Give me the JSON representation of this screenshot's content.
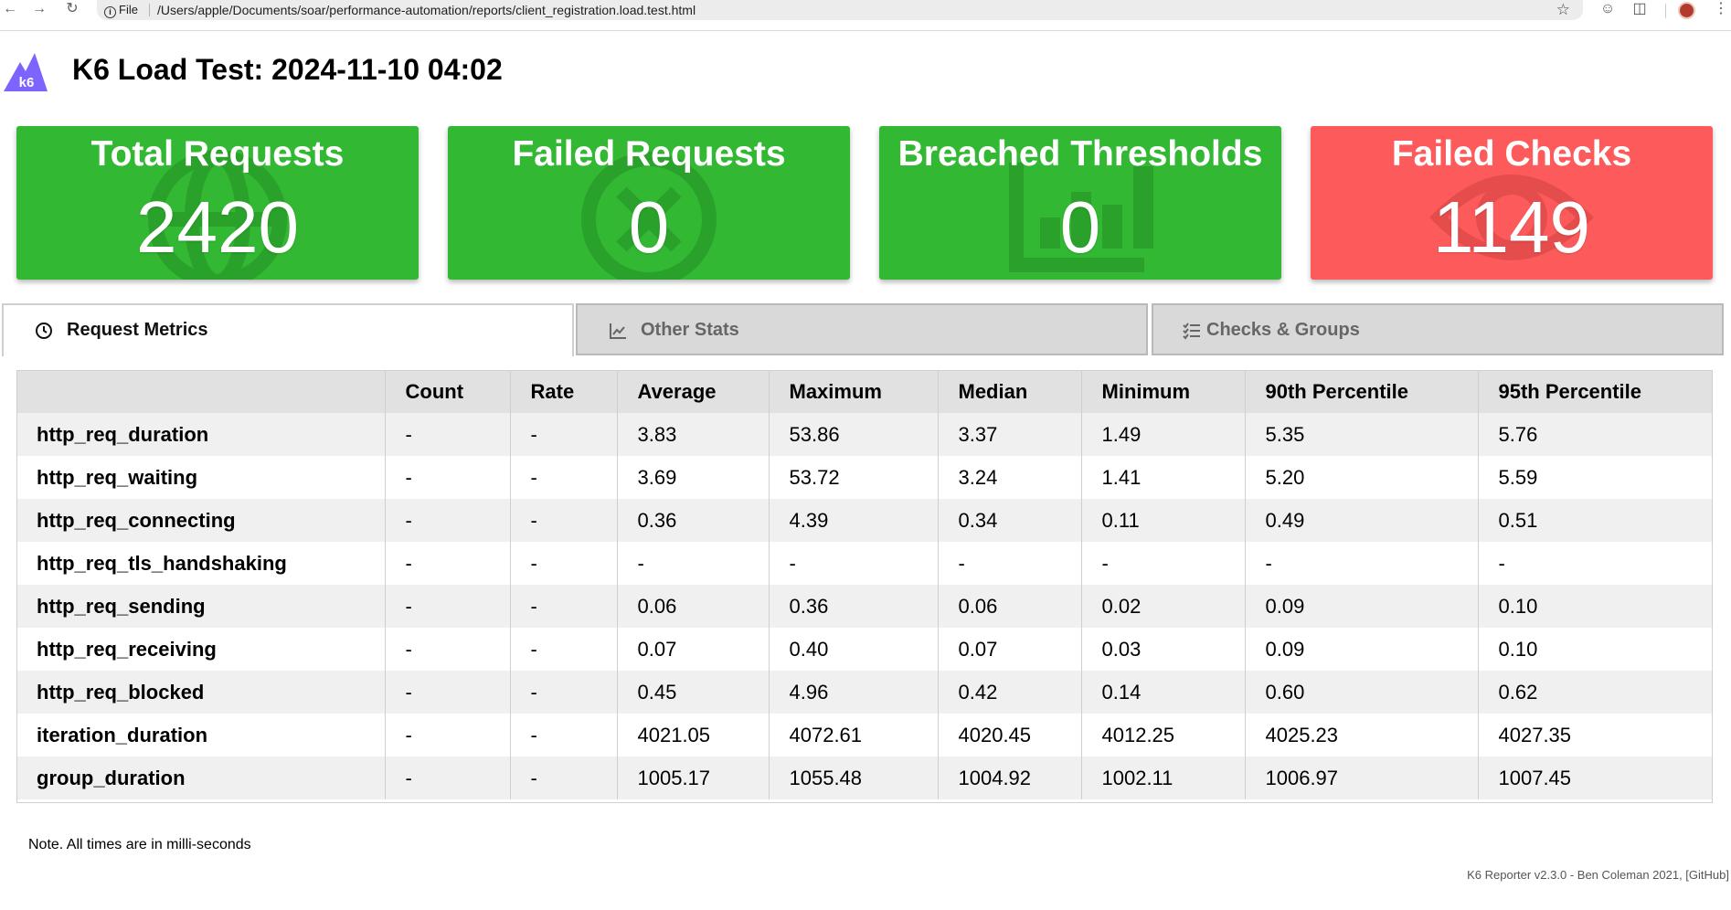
{
  "browser": {
    "file_label": "File",
    "url": "/Users/apple/Documents/soar/performance-automation/reports/client_registration.load.test.html"
  },
  "header": {
    "logo_text": "k6",
    "title": "K6 Load Test: 2024-11-10 04:02"
  },
  "stats": [
    {
      "label": "Total Requests",
      "value": "2420",
      "status": "ok",
      "icon": "globe-icon"
    },
    {
      "label": "Failed Requests",
      "value": "0",
      "status": "ok",
      "icon": "times-circle-icon"
    },
    {
      "label": "Breached Thresholds",
      "value": "0",
      "status": "ok",
      "icon": "chart-bar-icon"
    },
    {
      "label": "Failed Checks",
      "value": "1149",
      "status": "failed",
      "icon": "eye-icon"
    }
  ],
  "colors": {
    "ok": "#33b833",
    "failed": "#fd5b5b"
  },
  "tabs": [
    {
      "label": "Request Metrics",
      "icon": "clock-icon",
      "active": true
    },
    {
      "label": "Other Stats",
      "icon": "chart-line-icon",
      "active": false
    },
    {
      "label": "Checks & Groups",
      "icon": "tasks-icon",
      "active": false
    }
  ],
  "table": {
    "headers": [
      "",
      "Count",
      "Rate",
      "Average",
      "Maximum",
      "Median",
      "Minimum",
      "90th Percentile",
      "95th Percentile"
    ],
    "rows": [
      [
        "http_req_duration",
        "-",
        "-",
        "3.83",
        "53.86",
        "3.37",
        "1.49",
        "5.35",
        "5.76"
      ],
      [
        "http_req_waiting",
        "-",
        "-",
        "3.69",
        "53.72",
        "3.24",
        "1.41",
        "5.20",
        "5.59"
      ],
      [
        "http_req_connecting",
        "-",
        "-",
        "0.36",
        "4.39",
        "0.34",
        "0.11",
        "0.49",
        "0.51"
      ],
      [
        "http_req_tls_handshaking",
        "-",
        "-",
        "-",
        "-",
        "-",
        "-",
        "-",
        "-"
      ],
      [
        "http_req_sending",
        "-",
        "-",
        "0.06",
        "0.36",
        "0.06",
        "0.02",
        "0.09",
        "0.10"
      ],
      [
        "http_req_receiving",
        "-",
        "-",
        "0.07",
        "0.40",
        "0.07",
        "0.03",
        "0.09",
        "0.10"
      ],
      [
        "http_req_blocked",
        "-",
        "-",
        "0.45",
        "4.96",
        "0.42",
        "0.14",
        "0.60",
        "0.62"
      ],
      [
        "iteration_duration",
        "-",
        "-",
        "4021.05",
        "4072.61",
        "4020.45",
        "4012.25",
        "4025.23",
        "4027.35"
      ],
      [
        "group_duration",
        "-",
        "-",
        "1005.17",
        "1055.48",
        "1004.92",
        "1002.11",
        "1006.97",
        "1007.45"
      ]
    ]
  },
  "note": "Note. All times are in milli-seconds",
  "footer": "K6 Reporter v2.3.0 - Ben Coleman 2021, [GitHub]"
}
